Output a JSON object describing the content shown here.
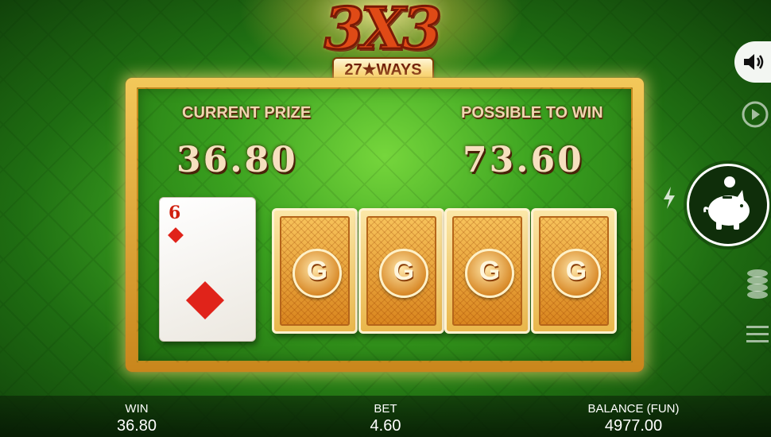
{
  "logo": {
    "title": "3X3",
    "subtitle": "27★WAYS"
  },
  "prizes": {
    "current_label": "CURRENT PRIZE",
    "current_value": "36.80",
    "possible_label": "POSSIBLE TO WIN",
    "possible_value": "73.60"
  },
  "cards": {
    "revealed": {
      "rank": "6",
      "suit": "diamonds"
    },
    "hidden": [
      {
        "emblem": "G"
      },
      {
        "emblem": "G"
      },
      {
        "emblem": "G"
      },
      {
        "emblem": "G"
      }
    ]
  },
  "controls": {
    "sound": "speaker-icon",
    "autoplay": "autoplay-icon",
    "turbo": "lightning-icon",
    "bank": "piggy-bank-icon",
    "bet": "coin-stack-icon",
    "menu": "menu-icon"
  },
  "bottom_bar": {
    "win_label": "WIN",
    "win_value": "36.80",
    "bet_label": "BET",
    "bet_value": "4.60",
    "balance_label": "BALANCE (FUN)",
    "balance_value": "4977.00"
  },
  "colors": {
    "felt": "#3aa11f",
    "table_rim": "#f3c85a",
    "prize_text": "#f6e0bf",
    "suit_red": "#e0231a"
  }
}
